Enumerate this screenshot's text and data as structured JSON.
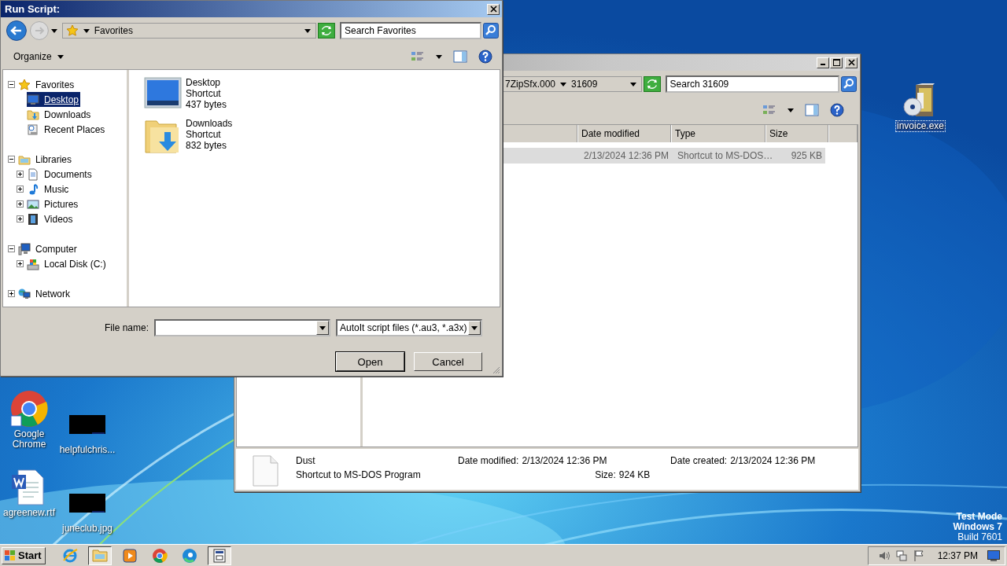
{
  "dialog": {
    "title": "Run Script:",
    "location": "Favorites",
    "search": {
      "placeholder": "Search Favorites"
    },
    "organize": "Organize",
    "nav": [
      {
        "label": "Favorites",
        "kind": "star",
        "expanded": true,
        "selected": false,
        "children": [
          {
            "label": "Desktop",
            "kind": "monitor",
            "selected": true
          },
          {
            "label": "Downloads",
            "kind": "download-folder",
            "selected": false
          },
          {
            "label": "Recent Places",
            "kind": "recent",
            "selected": false
          }
        ]
      },
      {
        "label": "Libraries",
        "kind": "library",
        "expanded": true,
        "selected": false,
        "children": [
          {
            "label": "Documents",
            "kind": "document",
            "expanded": false,
            "selected": false
          },
          {
            "label": "Music",
            "kind": "music",
            "expanded": false,
            "selected": false
          },
          {
            "label": "Pictures",
            "kind": "pictures",
            "expanded": false,
            "selected": false
          },
          {
            "label": "Videos",
            "kind": "film",
            "expanded": false,
            "selected": false
          }
        ]
      },
      {
        "label": "Computer",
        "kind": "computer",
        "expanded": true,
        "selected": false,
        "children": [
          {
            "label": "Local Disk (C:)",
            "kind": "drive",
            "expanded": false,
            "selected": false
          }
        ]
      },
      {
        "label": "Network",
        "kind": "network",
        "expanded": false,
        "selected": false
      }
    ],
    "files": [
      {
        "name": "Desktop",
        "type": "Shortcut",
        "size": "437 bytes",
        "kind": "monitor"
      },
      {
        "name": "Downloads",
        "type": "Shortcut",
        "size": "832 bytes",
        "kind": "download-folder"
      }
    ],
    "file_name_label": "File name:",
    "file_type": "AutoIt script files (*.au3, *.a3x)",
    "buttons": [
      "Open",
      "Cancel"
    ]
  },
  "explorer": {
    "breadcrumb": [
      "7ZipSfx.000",
      "31609"
    ],
    "search": {
      "placeholder": "Search 31609"
    },
    "columns": [
      "Date modified",
      "Type",
      "Size"
    ],
    "rows": [
      {
        "date": "2/13/2024 12:36 PM",
        "type": "Shortcut to MS-DOS…",
        "size": "925 KB",
        "selected": true
      }
    ],
    "details": {
      "name": "Dust",
      "type": "Shortcut to MS-DOS Program",
      "modified_label": "Date modified:",
      "modified": "2/13/2024 12:36 PM",
      "size_label": "Size:",
      "size": "924 KB",
      "created_label": "Date created:",
      "created": "2/13/2024 12:36 PM"
    }
  },
  "desktop_icons": [
    {
      "label": "invoice.exe",
      "kind": "installer",
      "selected": true
    },
    {
      "label": "Google Chrome",
      "kind": "chrome",
      "selected": false
    },
    {
      "label": "helpfulchris...",
      "kind": "black-image",
      "selected": false
    },
    {
      "label": "agreenew.rtf",
      "kind": "word",
      "selected": false
    },
    {
      "label": "juneclub.jpg",
      "kind": "black-image",
      "selected": false
    }
  ],
  "taskbar": {
    "start": "Start",
    "apps": [
      {
        "kind": "ie",
        "active": false
      },
      {
        "kind": "explorer",
        "active": true
      },
      {
        "kind": "media",
        "active": false
      },
      {
        "kind": "chrome",
        "active": false
      },
      {
        "kind": "edge",
        "active": false
      },
      {
        "kind": "autoit",
        "active": true
      }
    ],
    "clock": "12:37 PM"
  },
  "test_mode": [
    "Test Mode",
    "Windows 7",
    "Build 7601"
  ]
}
